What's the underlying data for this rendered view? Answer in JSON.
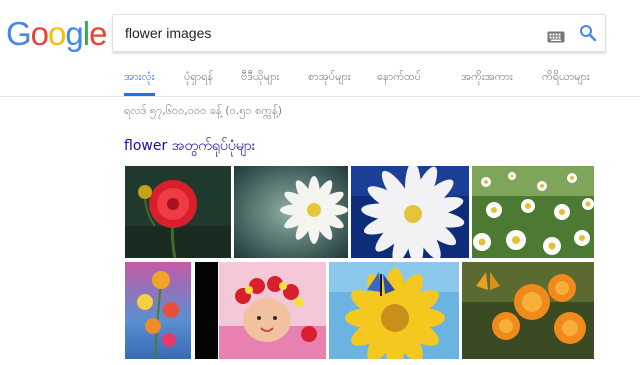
{
  "logo": {
    "text": "Google",
    "letters": [
      {
        "ch": "G",
        "color": "#4285F4"
      },
      {
        "ch": "o",
        "color": "#EA4335"
      },
      {
        "ch": "o",
        "color": "#FBBC05"
      },
      {
        "ch": "g",
        "color": "#4285F4"
      },
      {
        "ch": "l",
        "color": "#34A853"
      },
      {
        "ch": "e",
        "color": "#EA4335"
      }
    ]
  },
  "search": {
    "query": "flower images",
    "keyboard_icon": "keyboard-icon",
    "search_icon": "search-icon"
  },
  "tabs": [
    {
      "label": "အားလုံး",
      "active": true
    },
    {
      "label": "ပုံရှာရန်",
      "active": false
    },
    {
      "label": "ဗီဒီယိုများ",
      "active": false
    },
    {
      "label": "စာအုပ်များ",
      "active": false
    },
    {
      "label": "နောက်ထပ်",
      "active": false
    },
    {
      "label": "အကိုးအကား",
      "active": false
    },
    {
      "label": "ကိရိယာများ",
      "active": false
    }
  ],
  "results_stats": "ရလဒ် ၅၇,၆၀၀,၀၀၀ ခန့် (၀.၅၁ စက္ကန့်)",
  "images_section": {
    "heading": "flower အတွက်ရုပ်ပုံများ",
    "thumbnails": [
      "red-dahlia-thumbnail",
      "white-daisy-thumbnail",
      "daisy-dewdrops-thumbnail",
      "daisy-field-thumbnail",
      "colorful-blossoms-thumbnail",
      "dark-thumbnail",
      "baby-flower-wreath-thumbnail",
      "butterfly-sunflower-thumbnail",
      "butterfly-orange-flowers-thumbnail"
    ]
  },
  "colors": {
    "accent": "#1a73e8",
    "link": "#1a0dab",
    "muted": "#777777"
  }
}
